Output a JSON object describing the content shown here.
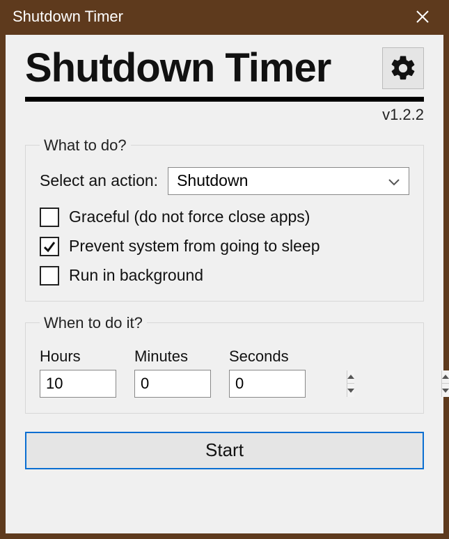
{
  "window": {
    "title": "Shutdown Timer"
  },
  "header": {
    "app_title": "Shutdown Timer",
    "version": "v1.2.2"
  },
  "what_to_do": {
    "legend": "What to do?",
    "select_label": "Select an action:",
    "selected_action": "Shutdown",
    "graceful": {
      "label": "Graceful (do not force close apps)",
      "checked": false
    },
    "prevent_sleep": {
      "label": "Prevent system from going to sleep",
      "checked": true
    },
    "run_background": {
      "label": "Run in background",
      "checked": false
    }
  },
  "when": {
    "legend": "When to do it?",
    "hours_label": "Hours",
    "hours_value": "10",
    "minutes_label": "Minutes",
    "minutes_value": "0",
    "seconds_label": "Seconds",
    "seconds_value": "0"
  },
  "start_label": "Start"
}
